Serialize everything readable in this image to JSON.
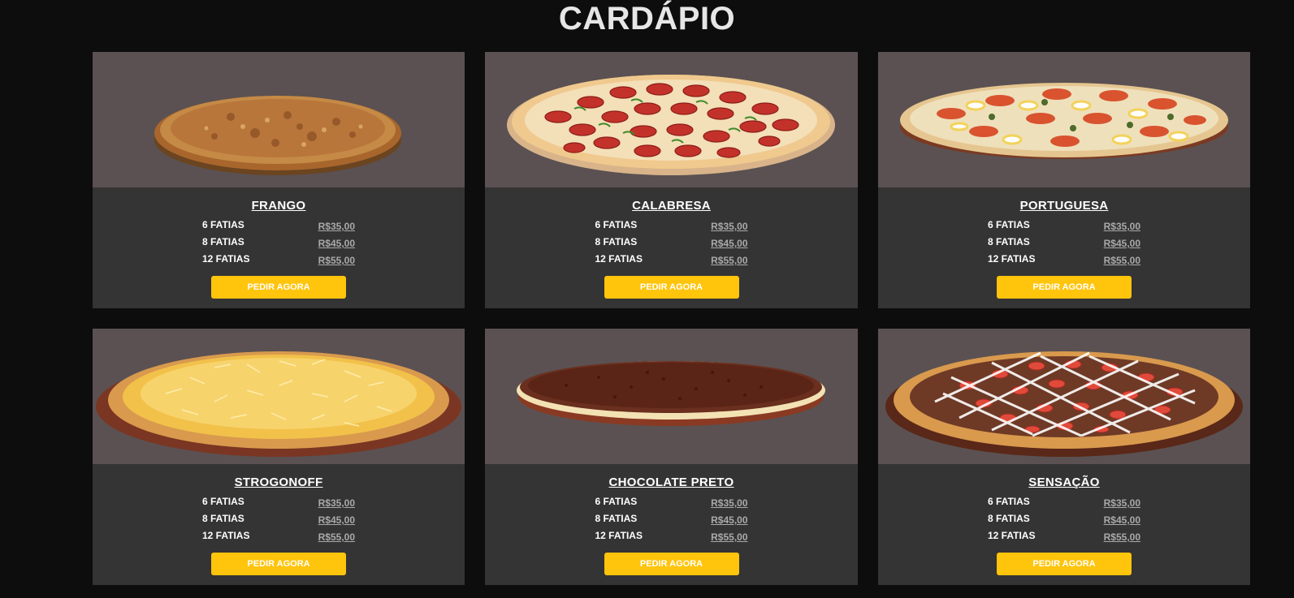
{
  "page": {
    "title": "CARDÁPIO"
  },
  "menu": {
    "button_label": "PEDIR AGORA",
    "size_labels": [
      "6 FATIAS",
      "8 FATIAS",
      "12 FATIAS"
    ],
    "items": [
      {
        "name": "FRANGO",
        "prices": [
          "R$35,00",
          "R$45,00",
          "R$55,00"
        ],
        "image": "pizza-frango"
      },
      {
        "name": "CALABRESA",
        "prices": [
          "R$35,00",
          "R$45,00",
          "R$55,00"
        ],
        "image": "pizza-calabresa"
      },
      {
        "name": "PORTUGUESA",
        "prices": [
          "R$35,00",
          "R$45,00",
          "R$55,00"
        ],
        "image": "pizza-portuguesa"
      },
      {
        "name": "STROGONOFF",
        "prices": [
          "R$35,00",
          "R$45,00",
          "R$55,00"
        ],
        "image": "pizza-strogonoff"
      },
      {
        "name": "CHOCOLATE PRETO",
        "prices": [
          "R$35,00",
          "R$45,00",
          "R$55,00"
        ],
        "image": "pizza-chocolate-preto"
      },
      {
        "name": "SENSAÇÃO",
        "prices": [
          "R$35,00",
          "R$45,00",
          "R$55,00"
        ],
        "image": "pizza-sensacao"
      }
    ]
  },
  "colors": {
    "page_bg": "#0d0d0d",
    "card_bg": "#343434",
    "photo_bg": "#5b5152",
    "button_bg": "#ffc40c",
    "price_text": "#a9a9a9"
  }
}
